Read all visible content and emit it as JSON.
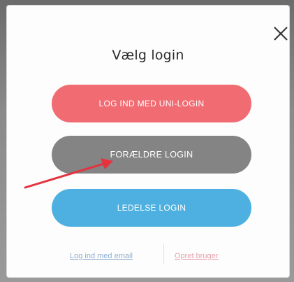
{
  "dialog": {
    "title": "Vælg login",
    "close_icon": "close-icon"
  },
  "buttons": {
    "uni_login": "LOG IND MED UNI-LOGIN",
    "parent_login": "FORÆLDRE LOGIN",
    "admin_login": "LEDELSE LOGIN"
  },
  "footer": {
    "email_link": "Log ind med email",
    "create_link": "Opret bruger"
  },
  "colors": {
    "uni": "#f16b73",
    "parent": "#848485",
    "admin": "#4db0e0",
    "annotation_arrow": "#e5323f"
  },
  "annotation": {
    "icon": "red-arrow-icon"
  }
}
